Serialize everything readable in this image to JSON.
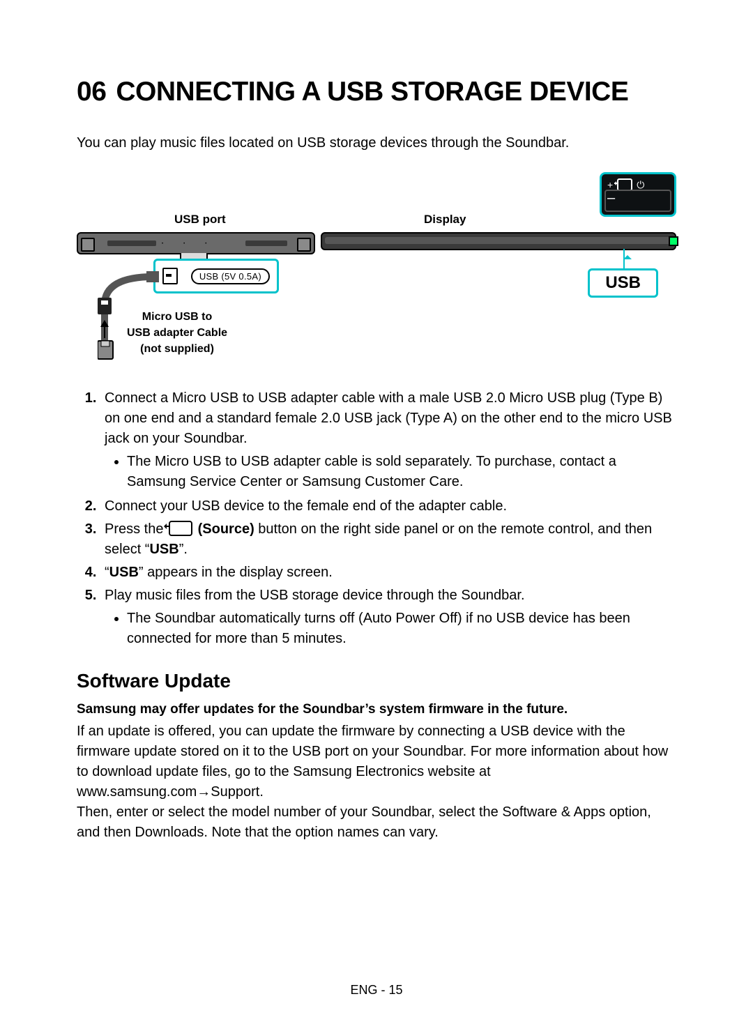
{
  "section_number": "06",
  "section_title": "CONNECTING A USB STORAGE DEVICE",
  "intro": "You can play music files located on USB storage devices through the Soundbar.",
  "diagram": {
    "usb_port_label": "USB port",
    "display_label": "Display",
    "port_badge": "USB (5V 0.5A)",
    "cable_label_l1": "Micro USB to",
    "cable_label_l2": "USB adapter Cable",
    "cable_label_l3": "(not supplied)",
    "usb_callout": "USB",
    "remote_plus": "+",
    "remote_minus": "–",
    "remote_power": "⏻"
  },
  "steps": {
    "s1": "Connect a Micro USB to USB adapter cable with a male USB 2.0 Micro USB plug (Type B) on one end and a standard female 2.0 USB jack (Type A) on the other end to the micro USB jack on your Soundbar.",
    "s1_bullet": "The Micro USB to USB adapter cable is sold separately. To purchase, contact a Samsung Service Center or Samsung Customer Care.",
    "s2": "Connect your USB device to the female end of the adapter cable.",
    "s3_a": "Press the ",
    "s3_source": " (Source)",
    "s3_b": " button on the right side panel or on the remote control, and then select “",
    "s3_usb": "USB",
    "s3_c": "”.",
    "s4_a": "“",
    "s4_usb": "USB",
    "s4_b": "” appears in the display screen.",
    "s5": "Play music files from the USB storage device through the Soundbar.",
    "s5_bullet": "The Soundbar automatically turns off (Auto Power Off) if no USB device has been connected for more than 5 minutes."
  },
  "update": {
    "heading": "Software Update",
    "lead": "Samsung may offer updates for the Soundbar’s system firmware in the future.",
    "body1": "If an update is offered, you can update the firmware by connecting a USB device with the firmware update stored on it to the USB port on your Soundbar. For more information about how to download update files, go to the Samsung Electronics website at www.samsung.com",
    "body1_arrow": "→",
    "body1_tail": "Support.",
    "body2": "Then, enter or select the model number of your Soundbar, select the Software & Apps option, and then Downloads. Note that the option names can vary."
  },
  "footer": "ENG - 15"
}
